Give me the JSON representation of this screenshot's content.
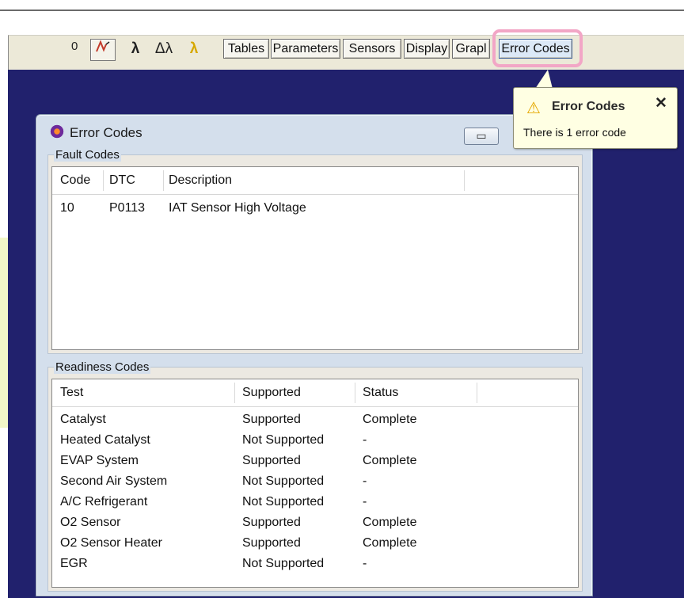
{
  "toolbar": {
    "counter": "0",
    "icons": [
      "gauge-icon",
      "lambda-icon",
      "double-lambda-icon",
      "yellow-lambda-icon"
    ],
    "buttons": [
      "Tables",
      "Parameters",
      "Sensors",
      "Display",
      "Grapl",
      "Error Codes"
    ],
    "active_button": "Error Codes",
    "highlight_color": "#f2a6c6"
  },
  "tooltip": {
    "title": "Error Codes",
    "message": "There is 1 error code",
    "close_label": "✕",
    "icon": "warning-icon"
  },
  "window": {
    "title": "Error Codes",
    "minimize_label": "▭"
  },
  "fault_codes": {
    "label": "Fault Codes",
    "headers": [
      "Code",
      "DTC",
      "Description"
    ],
    "rows": [
      [
        "10",
        "P0113",
        "IAT Sensor High Voltage"
      ]
    ]
  },
  "readiness_codes": {
    "label": "Readiness Codes",
    "headers": [
      "Test",
      "Supported",
      "Status"
    ],
    "rows": [
      [
        "Catalyst",
        "Supported",
        "Complete"
      ],
      [
        "Heated Catalyst",
        "Not Supported",
        "-"
      ],
      [
        "EVAP System",
        "Supported",
        "Complete"
      ],
      [
        "Second Air System",
        "Not Supported",
        "-"
      ],
      [
        "A/C Refrigerant",
        "Not Supported",
        "-"
      ],
      [
        "O2 Sensor",
        "Supported",
        "Complete"
      ],
      [
        "O2 Sensor Heater",
        "Supported",
        "Complete"
      ],
      [
        "EGR",
        "Not Supported",
        "-"
      ]
    ]
  },
  "colors": {
    "desktop": "#21216d",
    "tooltip_bg": "#ffffe3"
  }
}
